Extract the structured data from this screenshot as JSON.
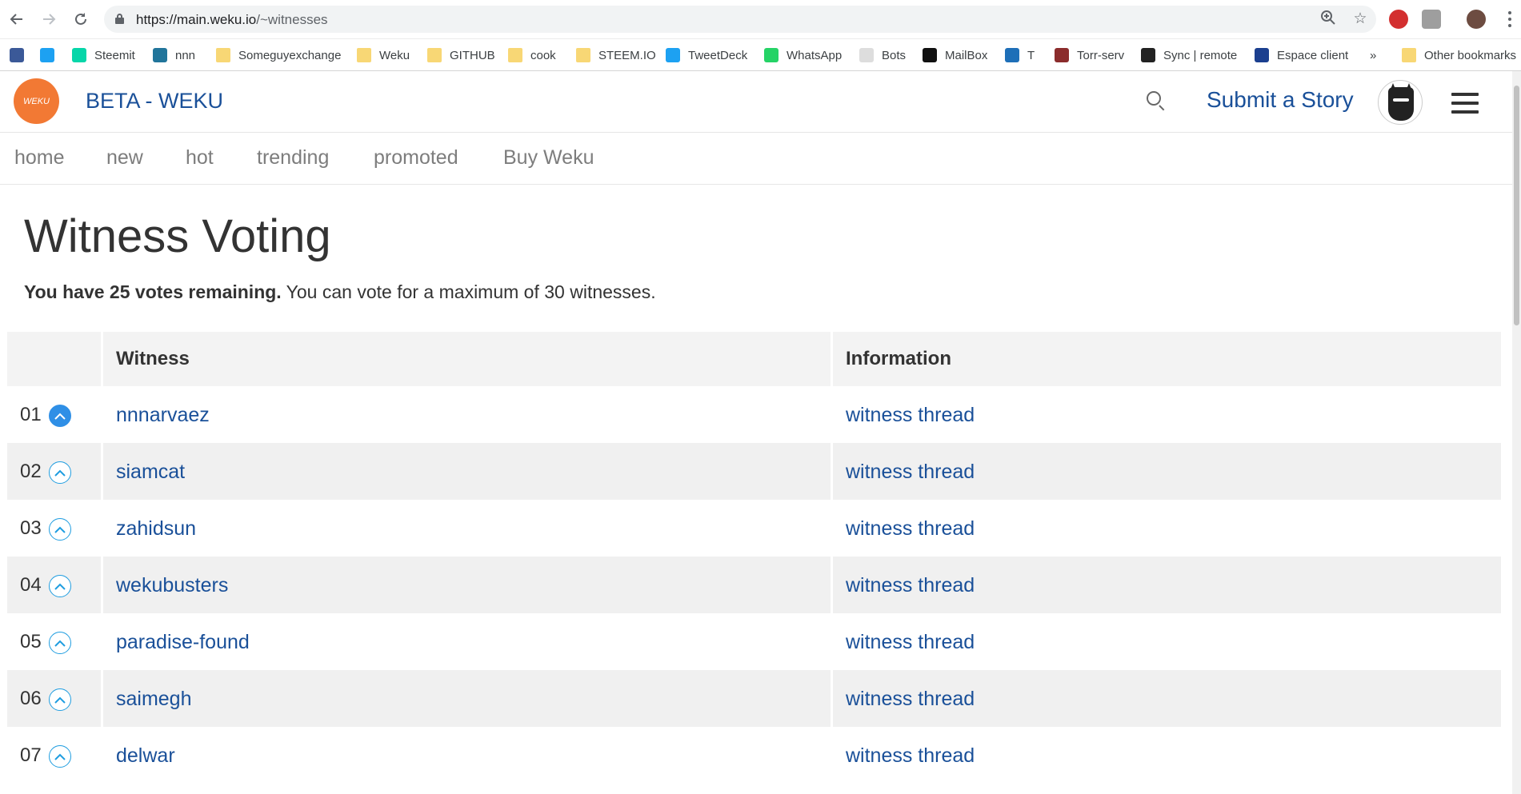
{
  "browser": {
    "url_host": "https://main.weku.io",
    "url_path": "/~witnesses",
    "bookmarks": [
      {
        "label": "",
        "icon": "facebook-icon",
        "color": "#3b5998"
      },
      {
        "label": "",
        "icon": "twitter-icon",
        "color": "#1da1f2"
      },
      {
        "label": "Steemit",
        "icon": "steemit-icon",
        "color": "#06d6a9"
      },
      {
        "label": "nnn",
        "icon": "wordpress-icon",
        "color": "#21759b"
      },
      {
        "label": "Someguyexchange",
        "icon": "folder-icon",
        "color": "#f8d775"
      },
      {
        "label": "Weku",
        "icon": "folder-icon",
        "color": "#f8d775"
      },
      {
        "label": "GITHUB",
        "icon": "folder-icon",
        "color": "#f8d775"
      },
      {
        "label": "cook",
        "icon": "folder-icon",
        "color": "#f8d775"
      },
      {
        "label": "STEEM.IO",
        "icon": "folder-icon",
        "color": "#f8d775"
      },
      {
        "label": "TweetDeck",
        "icon": "tweetdeck-icon",
        "color": "#1da1f2"
      },
      {
        "label": "WhatsApp",
        "icon": "whatsapp-icon",
        "color": "#25d366"
      },
      {
        "label": "Bots",
        "icon": "bots-icon",
        "color": "#dddddd"
      },
      {
        "label": "MailBox",
        "icon": "mailbox-icon",
        "color": "#111111"
      },
      {
        "label": "T",
        "icon": "t2-icon",
        "color": "#1e6fb8"
      },
      {
        "label": "Torr-serv",
        "icon": "torr-serv-icon",
        "color": "#8b2c2c"
      },
      {
        "label": "Sync | remote",
        "icon": "sync-icon",
        "color": "#222222"
      },
      {
        "label": "Espace client",
        "icon": "espace-client-icon",
        "color": "#1b3f8f"
      }
    ],
    "more_bookmarks": "»",
    "other_bookmarks": "Other bookmarks"
  },
  "header": {
    "brand": "BETA - WEKU",
    "logo_text": "WEKU",
    "submit_label": "Submit a Story"
  },
  "nav": {
    "items": [
      "home",
      "new",
      "hot",
      "trending",
      "promoted",
      "Buy Weku"
    ]
  },
  "main": {
    "title": "Witness Voting",
    "votes_bold": "You have 25 votes remaining.",
    "votes_rest": " You can vote for a maximum of 30 witnesses."
  },
  "table": {
    "headers": {
      "witness": "Witness",
      "information": "Information"
    },
    "rows": [
      {
        "rank": "01",
        "name": "nnnarvaez",
        "info": "witness thread",
        "voted": true
      },
      {
        "rank": "02",
        "name": "siamcat",
        "info": "witness thread",
        "voted": false
      },
      {
        "rank": "03",
        "name": "zahidsun",
        "info": "witness thread",
        "voted": false
      },
      {
        "rank": "04",
        "name": "wekubusters",
        "info": "witness thread",
        "voted": false
      },
      {
        "rank": "05",
        "name": "paradise-found",
        "info": "witness thread",
        "voted": false
      },
      {
        "rank": "06",
        "name": "saimegh",
        "info": "witness thread",
        "voted": false
      },
      {
        "rank": "07",
        "name": "delwar",
        "info": "witness thread",
        "voted": false
      }
    ]
  },
  "colors": {
    "link": "#1a5099",
    "accent": "#f27934",
    "vote_active": "#2f8fe6"
  }
}
